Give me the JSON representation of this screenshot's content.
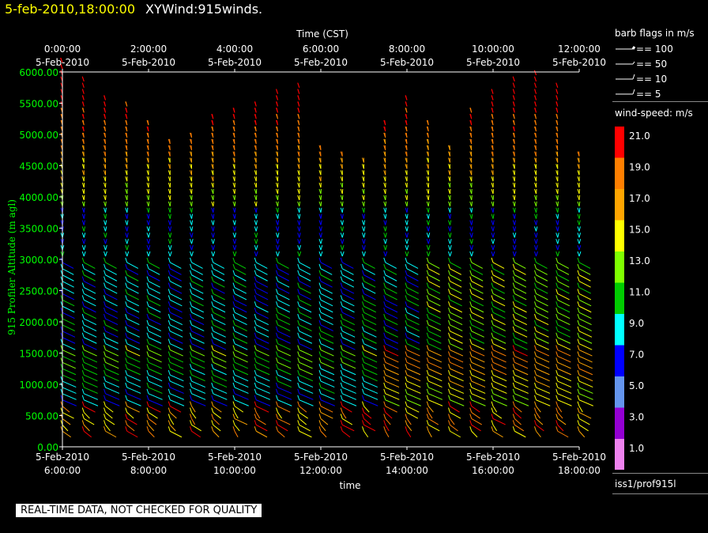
{
  "header": {
    "date_time": "5-feb-2010,18:00:00",
    "product": "XYWind:915winds."
  },
  "chart_data": {
    "type": "scatter",
    "subtype": "wind-barb time-height plot",
    "top_axis_title": "Time (CST)",
    "xlabel": "time",
    "ylabel": "915 Profiler Altitude (m agl)",
    "ylim": [
      0,
      6000
    ],
    "y_ticks": [
      "0.00",
      "500.00",
      "1000.00",
      "1500.00",
      "2000.00",
      "2500.00",
      "3000.00",
      "3500.00",
      "4000.00",
      "4500.00",
      "5000.00",
      "5500.00",
      "6000.00"
    ],
    "x_ticks_bottom": [
      {
        "date": "5-Feb-2010",
        "time": "6:00:00"
      },
      {
        "date": "5-Feb-2010",
        "time": "8:00:00"
      },
      {
        "date": "5-Feb-2010",
        "time": "10:00:00"
      },
      {
        "date": "5-Feb-2010",
        "time": "12:00:00"
      },
      {
        "date": "5-Feb-2010",
        "time": "14:00:00"
      },
      {
        "date": "5-Feb-2010",
        "time": "16:00:00"
      },
      {
        "date": "5-Feb-2010",
        "time": "18:00:00"
      }
    ],
    "x_ticks_top": [
      {
        "time": "0:00:00",
        "date": "5-Feb-2010"
      },
      {
        "time": "2:00:00",
        "date": "5-Feb-2010"
      },
      {
        "time": "4:00:00",
        "date": "5-Feb-2010"
      },
      {
        "time": "6:00:00",
        "date": "5-Feb-2010"
      },
      {
        "time": "8:00:00",
        "date": "5-Feb-2010"
      },
      {
        "time": "10:00:00",
        "date": "5-Feb-2010"
      },
      {
        "time": "12:00:00",
        "date": "5-Feb-2010"
      }
    ],
    "x_range_hours_utc": [
      6,
      18
    ],
    "profile_times_hours_utc": [
      6.0,
      6.5,
      7.0,
      7.5,
      8.0,
      8.5,
      9.0,
      9.5,
      10.0,
      10.5,
      11.0,
      11.5,
      12.0,
      12.5,
      13.0,
      13.5,
      14.0,
      14.5,
      15.0,
      15.5,
      16.0,
      16.5,
      17.0,
      17.5,
      18.0
    ],
    "profile_top_heights_m": [
      6150,
      5900,
      5600,
      5500,
      5150,
      4900,
      5000,
      5300,
      5400,
      5500,
      5700,
      5800,
      4800,
      4700,
      4600,
      5200,
      5600,
      5200,
      4800,
      5400,
      5700,
      5900,
      6000,
      5800,
      4700
    ],
    "barb_flags": [
      {
        "label": "== 100",
        "speed": 100
      },
      {
        "label": "== 50",
        "speed": 50
      },
      {
        "label": "== 10",
        "speed": 10
      },
      {
        "label": "== 5",
        "speed": 5
      }
    ],
    "speed_scale": [
      {
        "label": "21.0",
        "color": "#ff0000"
      },
      {
        "label": "19.0",
        "color": "#ff7f00"
      },
      {
        "label": "17.0",
        "color": "#ffa500"
      },
      {
        "label": "15.0",
        "color": "#ffff00"
      },
      {
        "label": "13.0",
        "color": "#7fff00"
      },
      {
        "label": "11.0",
        "color": "#00cc00"
      },
      {
        "label": "9.0",
        "color": "#00ffff"
      },
      {
        "label": "7.0",
        "color": "#0000ff"
      },
      {
        "label": "5.0",
        "color": "#6495ed"
      },
      {
        "label": "3.0",
        "color": "#9400d3"
      },
      {
        "label": "1.0",
        "color": "#ee82ee"
      }
    ],
    "axis_color": "#ffffff",
    "y_tick_label_color": "#00ff00"
  },
  "legend": {
    "barb_title": "barb flags in m/s",
    "speed_title": "wind-speed: m/s"
  },
  "station": "iss1/prof915l",
  "notice": "REAL-TIME DATA, NOT CHECKED FOR QUALITY"
}
